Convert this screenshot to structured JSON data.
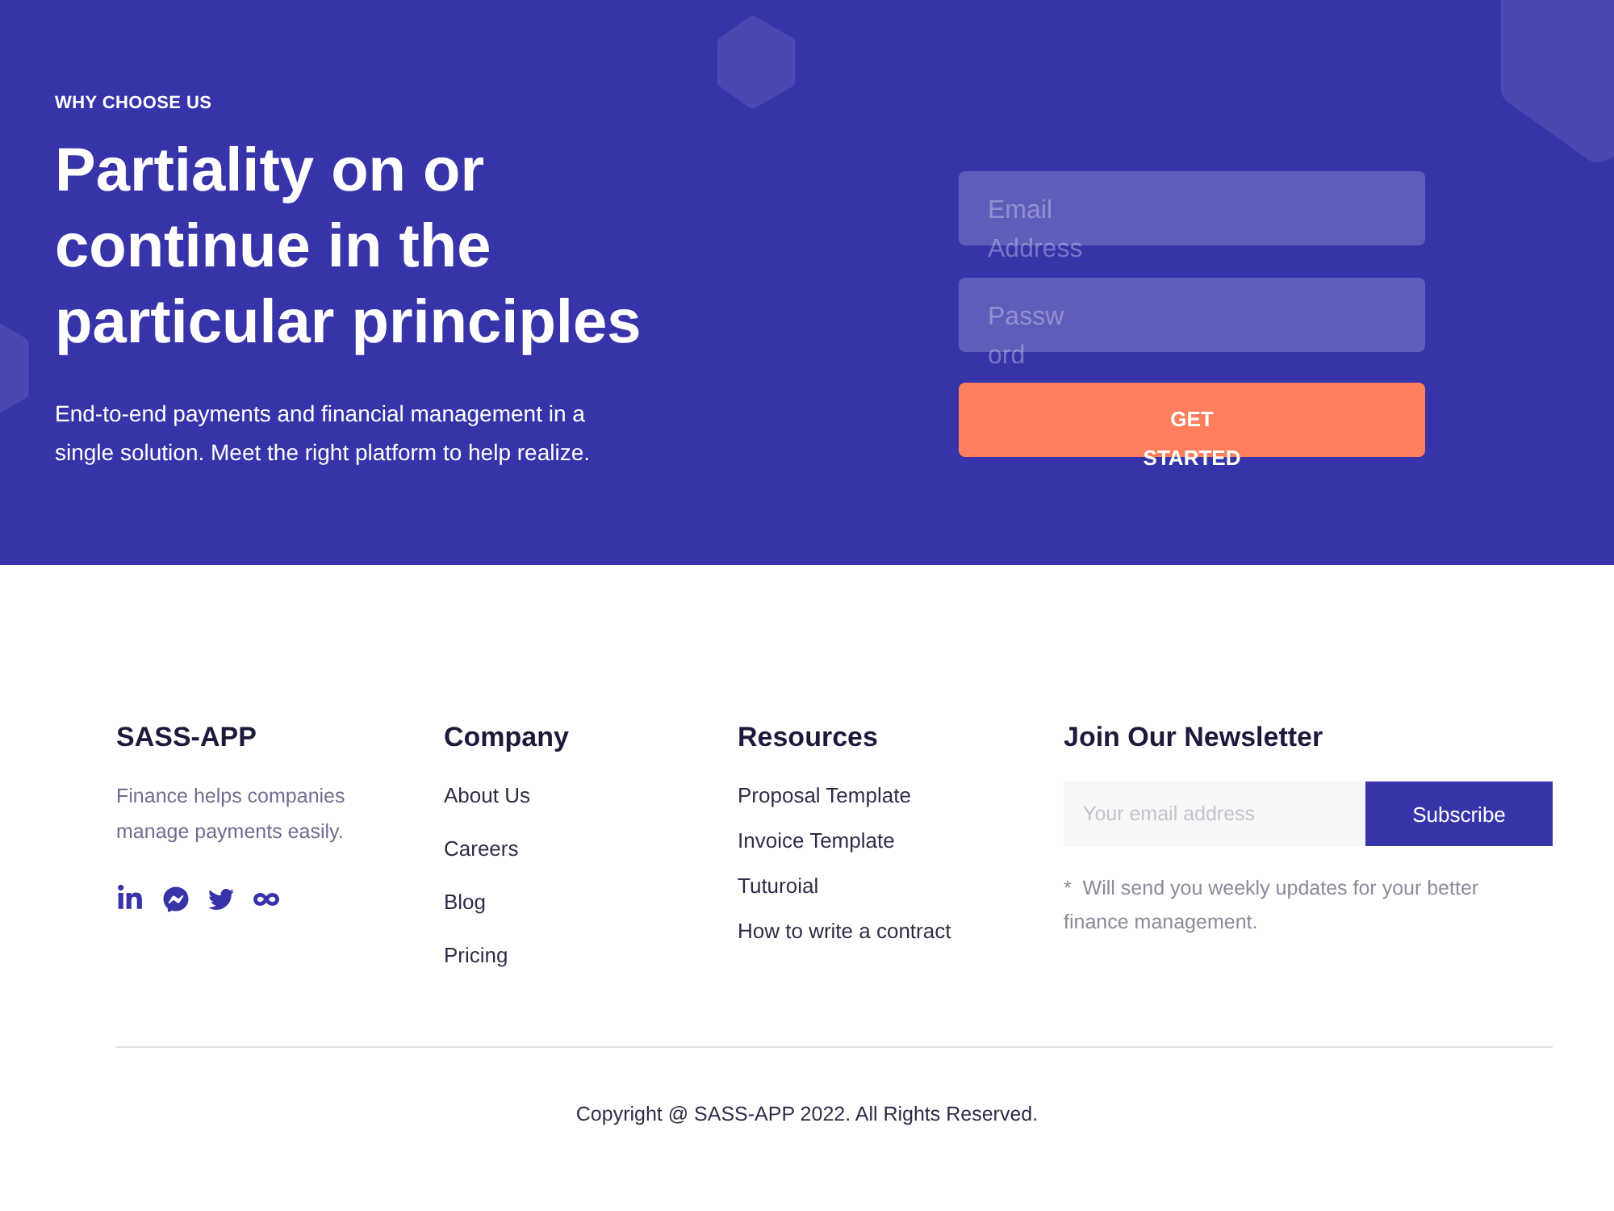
{
  "hero": {
    "eyebrow": "WHY CHOOSE US",
    "heading": "Partiality on or continue in the particular principles",
    "text": "End-to-end payments and financial management in a single solution. Meet the right platform to help realize.",
    "form": {
      "fields": [
        {
          "kind": "email",
          "placeholder": "Email Address"
        },
        {
          "kind": "password",
          "placeholder": "Password"
        }
      ],
      "button": "GET STARTED"
    }
  },
  "footer": {
    "brand": {
      "name": "SASS-APP",
      "description": "Finance helps companies manage payments easily."
    },
    "columns": [
      {
        "title": "Company",
        "links": [
          "About Us",
          "Careers",
          "Blog",
          "Pricing"
        ]
      },
      {
        "title": "Resources",
        "links": [
          "Proposal Template",
          "Invoice Template",
          "Tuturoial",
          "How to write a contract"
        ]
      }
    ],
    "newsletter": {
      "title": "Join Our Newsletter",
      "placeholder": "Your email address",
      "button": "Subscribe",
      "note": "*  Will send you weekly updates for your better finance management."
    },
    "copyright": "Copyright @ SASS-APP 2022. All Rights Reserved."
  }
}
